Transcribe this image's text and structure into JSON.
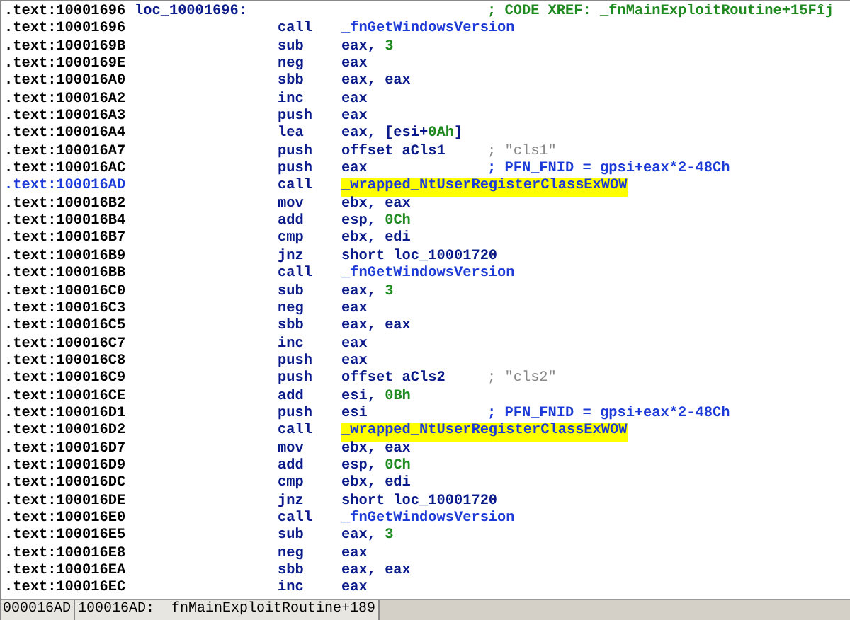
{
  "lines": [
    {
      "address": ".text:10001696",
      "label": "loc_10001696:",
      "comment": {
        "text": "; CODE XREF: _fnMainExploitRoutine+15Fîj",
        "kind": "xref"
      },
      "selected": false
    },
    {
      "address": ".text:10001696",
      "mnemonic": "call",
      "operands": [
        {
          "text": "_fnGetWindowsVersion",
          "kind": "symbol"
        }
      ],
      "selected": false
    },
    {
      "address": ".text:1000169B",
      "mnemonic": "sub",
      "operands": [
        {
          "text": "eax, ",
          "kind": "plain"
        },
        {
          "text": "3",
          "kind": "number"
        }
      ],
      "selected": false
    },
    {
      "address": ".text:1000169E",
      "mnemonic": "neg",
      "operands": [
        {
          "text": "eax",
          "kind": "plain"
        }
      ],
      "selected": false
    },
    {
      "address": ".text:100016A0",
      "mnemonic": "sbb",
      "operands": [
        {
          "text": "eax, eax",
          "kind": "plain"
        }
      ],
      "selected": false
    },
    {
      "address": ".text:100016A2",
      "mnemonic": "inc",
      "operands": [
        {
          "text": "eax",
          "kind": "plain"
        }
      ],
      "selected": false
    },
    {
      "address": ".text:100016A3",
      "mnemonic": "push",
      "operands": [
        {
          "text": "eax",
          "kind": "plain"
        }
      ],
      "selected": false
    },
    {
      "address": ".text:100016A4",
      "mnemonic": "lea",
      "operands": [
        {
          "text": "eax, [esi+",
          "kind": "plain"
        },
        {
          "text": "0Ah",
          "kind": "number"
        },
        {
          "text": "]",
          "kind": "plain"
        }
      ],
      "selected": false
    },
    {
      "address": ".text:100016A7",
      "mnemonic": "push",
      "operands": [
        {
          "text": "offset aCls1",
          "kind": "plain"
        }
      ],
      "comment": {
        "text": "; \"cls1\"",
        "kind": "string"
      },
      "selected": false
    },
    {
      "address": ".text:100016AC",
      "mnemonic": "push",
      "operands": [
        {
          "text": "eax",
          "kind": "plain"
        }
      ],
      "comment": {
        "text": "; PFN_FNID = gpsi+eax*2-48Ch",
        "kind": "note"
      },
      "selected": false
    },
    {
      "address": ".text:100016AD",
      "mnemonic": "call",
      "operands": [
        {
          "text": "_wrapped_NtUserRegisterClassExWOW",
          "kind": "highlighted"
        }
      ],
      "selected": true
    },
    {
      "address": ".text:100016B2",
      "mnemonic": "mov",
      "operands": [
        {
          "text": "ebx, eax",
          "kind": "plain"
        }
      ],
      "selected": false
    },
    {
      "address": ".text:100016B4",
      "mnemonic": "add",
      "operands": [
        {
          "text": "esp, ",
          "kind": "plain"
        },
        {
          "text": "0Ch",
          "kind": "number"
        }
      ],
      "selected": false
    },
    {
      "address": ".text:100016B7",
      "mnemonic": "cmp",
      "operands": [
        {
          "text": "ebx, edi",
          "kind": "plain"
        }
      ],
      "selected": false
    },
    {
      "address": ".text:100016B9",
      "mnemonic": "jnz",
      "operands": [
        {
          "text": "short loc_10001720",
          "kind": "plain"
        }
      ],
      "selected": false
    },
    {
      "address": ".text:100016BB",
      "mnemonic": "call",
      "operands": [
        {
          "text": "_fnGetWindowsVersion",
          "kind": "symbol"
        }
      ],
      "selected": false
    },
    {
      "address": ".text:100016C0",
      "mnemonic": "sub",
      "operands": [
        {
          "text": "eax, ",
          "kind": "plain"
        },
        {
          "text": "3",
          "kind": "number"
        }
      ],
      "selected": false
    },
    {
      "address": ".text:100016C3",
      "mnemonic": "neg",
      "operands": [
        {
          "text": "eax",
          "kind": "plain"
        }
      ],
      "selected": false
    },
    {
      "address": ".text:100016C5",
      "mnemonic": "sbb",
      "operands": [
        {
          "text": "eax, eax",
          "kind": "plain"
        }
      ],
      "selected": false
    },
    {
      "address": ".text:100016C7",
      "mnemonic": "inc",
      "operands": [
        {
          "text": "eax",
          "kind": "plain"
        }
      ],
      "selected": false
    },
    {
      "address": ".text:100016C8",
      "mnemonic": "push",
      "operands": [
        {
          "text": "eax",
          "kind": "plain"
        }
      ],
      "selected": false
    },
    {
      "address": ".text:100016C9",
      "mnemonic": "push",
      "operands": [
        {
          "text": "offset aCls2",
          "kind": "plain"
        }
      ],
      "comment": {
        "text": "; \"cls2\"",
        "kind": "string"
      },
      "selected": false
    },
    {
      "address": ".text:100016CE",
      "mnemonic": "add",
      "operands": [
        {
          "text": "esi, ",
          "kind": "plain"
        },
        {
          "text": "0Bh",
          "kind": "number"
        }
      ],
      "selected": false
    },
    {
      "address": ".text:100016D1",
      "mnemonic": "push",
      "operands": [
        {
          "text": "esi",
          "kind": "plain"
        }
      ],
      "comment": {
        "text": "; PFN_FNID = gpsi+eax*2-48Ch",
        "kind": "note"
      },
      "selected": false
    },
    {
      "address": ".text:100016D2",
      "mnemonic": "call",
      "operands": [
        {
          "text": "_wrapped_NtUserRegisterClassExWOW",
          "kind": "highlighted"
        }
      ],
      "selected": false
    },
    {
      "address": ".text:100016D7",
      "mnemonic": "mov",
      "operands": [
        {
          "text": "ebx, eax",
          "kind": "plain"
        }
      ],
      "selected": false
    },
    {
      "address": ".text:100016D9",
      "mnemonic": "add",
      "operands": [
        {
          "text": "esp, ",
          "kind": "plain"
        },
        {
          "text": "0Ch",
          "kind": "number"
        }
      ],
      "selected": false
    },
    {
      "address": ".text:100016DC",
      "mnemonic": "cmp",
      "operands": [
        {
          "text": "ebx, edi",
          "kind": "plain"
        }
      ],
      "selected": false
    },
    {
      "address": ".text:100016DE",
      "mnemonic": "jnz",
      "operands": [
        {
          "text": "short loc_10001720",
          "kind": "plain"
        }
      ],
      "selected": false
    },
    {
      "address": ".text:100016E0",
      "mnemonic": "call",
      "operands": [
        {
          "text": "_fnGetWindowsVersion",
          "kind": "symbol"
        }
      ],
      "selected": false
    },
    {
      "address": ".text:100016E5",
      "mnemonic": "sub",
      "operands": [
        {
          "text": "eax, ",
          "kind": "plain"
        },
        {
          "text": "3",
          "kind": "number"
        }
      ],
      "selected": false
    },
    {
      "address": ".text:100016E8",
      "mnemonic": "neg",
      "operands": [
        {
          "text": "eax",
          "kind": "plain"
        }
      ],
      "selected": false
    },
    {
      "address": ".text:100016EA",
      "mnemonic": "sbb",
      "operands": [
        {
          "text": "eax, eax",
          "kind": "plain"
        }
      ],
      "selected": false
    },
    {
      "address": ".text:100016EC",
      "mnemonic": "inc",
      "operands": [
        {
          "text": "eax",
          "kind": "plain"
        }
      ],
      "selected": false
    }
  ],
  "status_bar": {
    "offset": "000016AD",
    "location": "100016AD:  fnMainExploitRoutine+189"
  }
}
